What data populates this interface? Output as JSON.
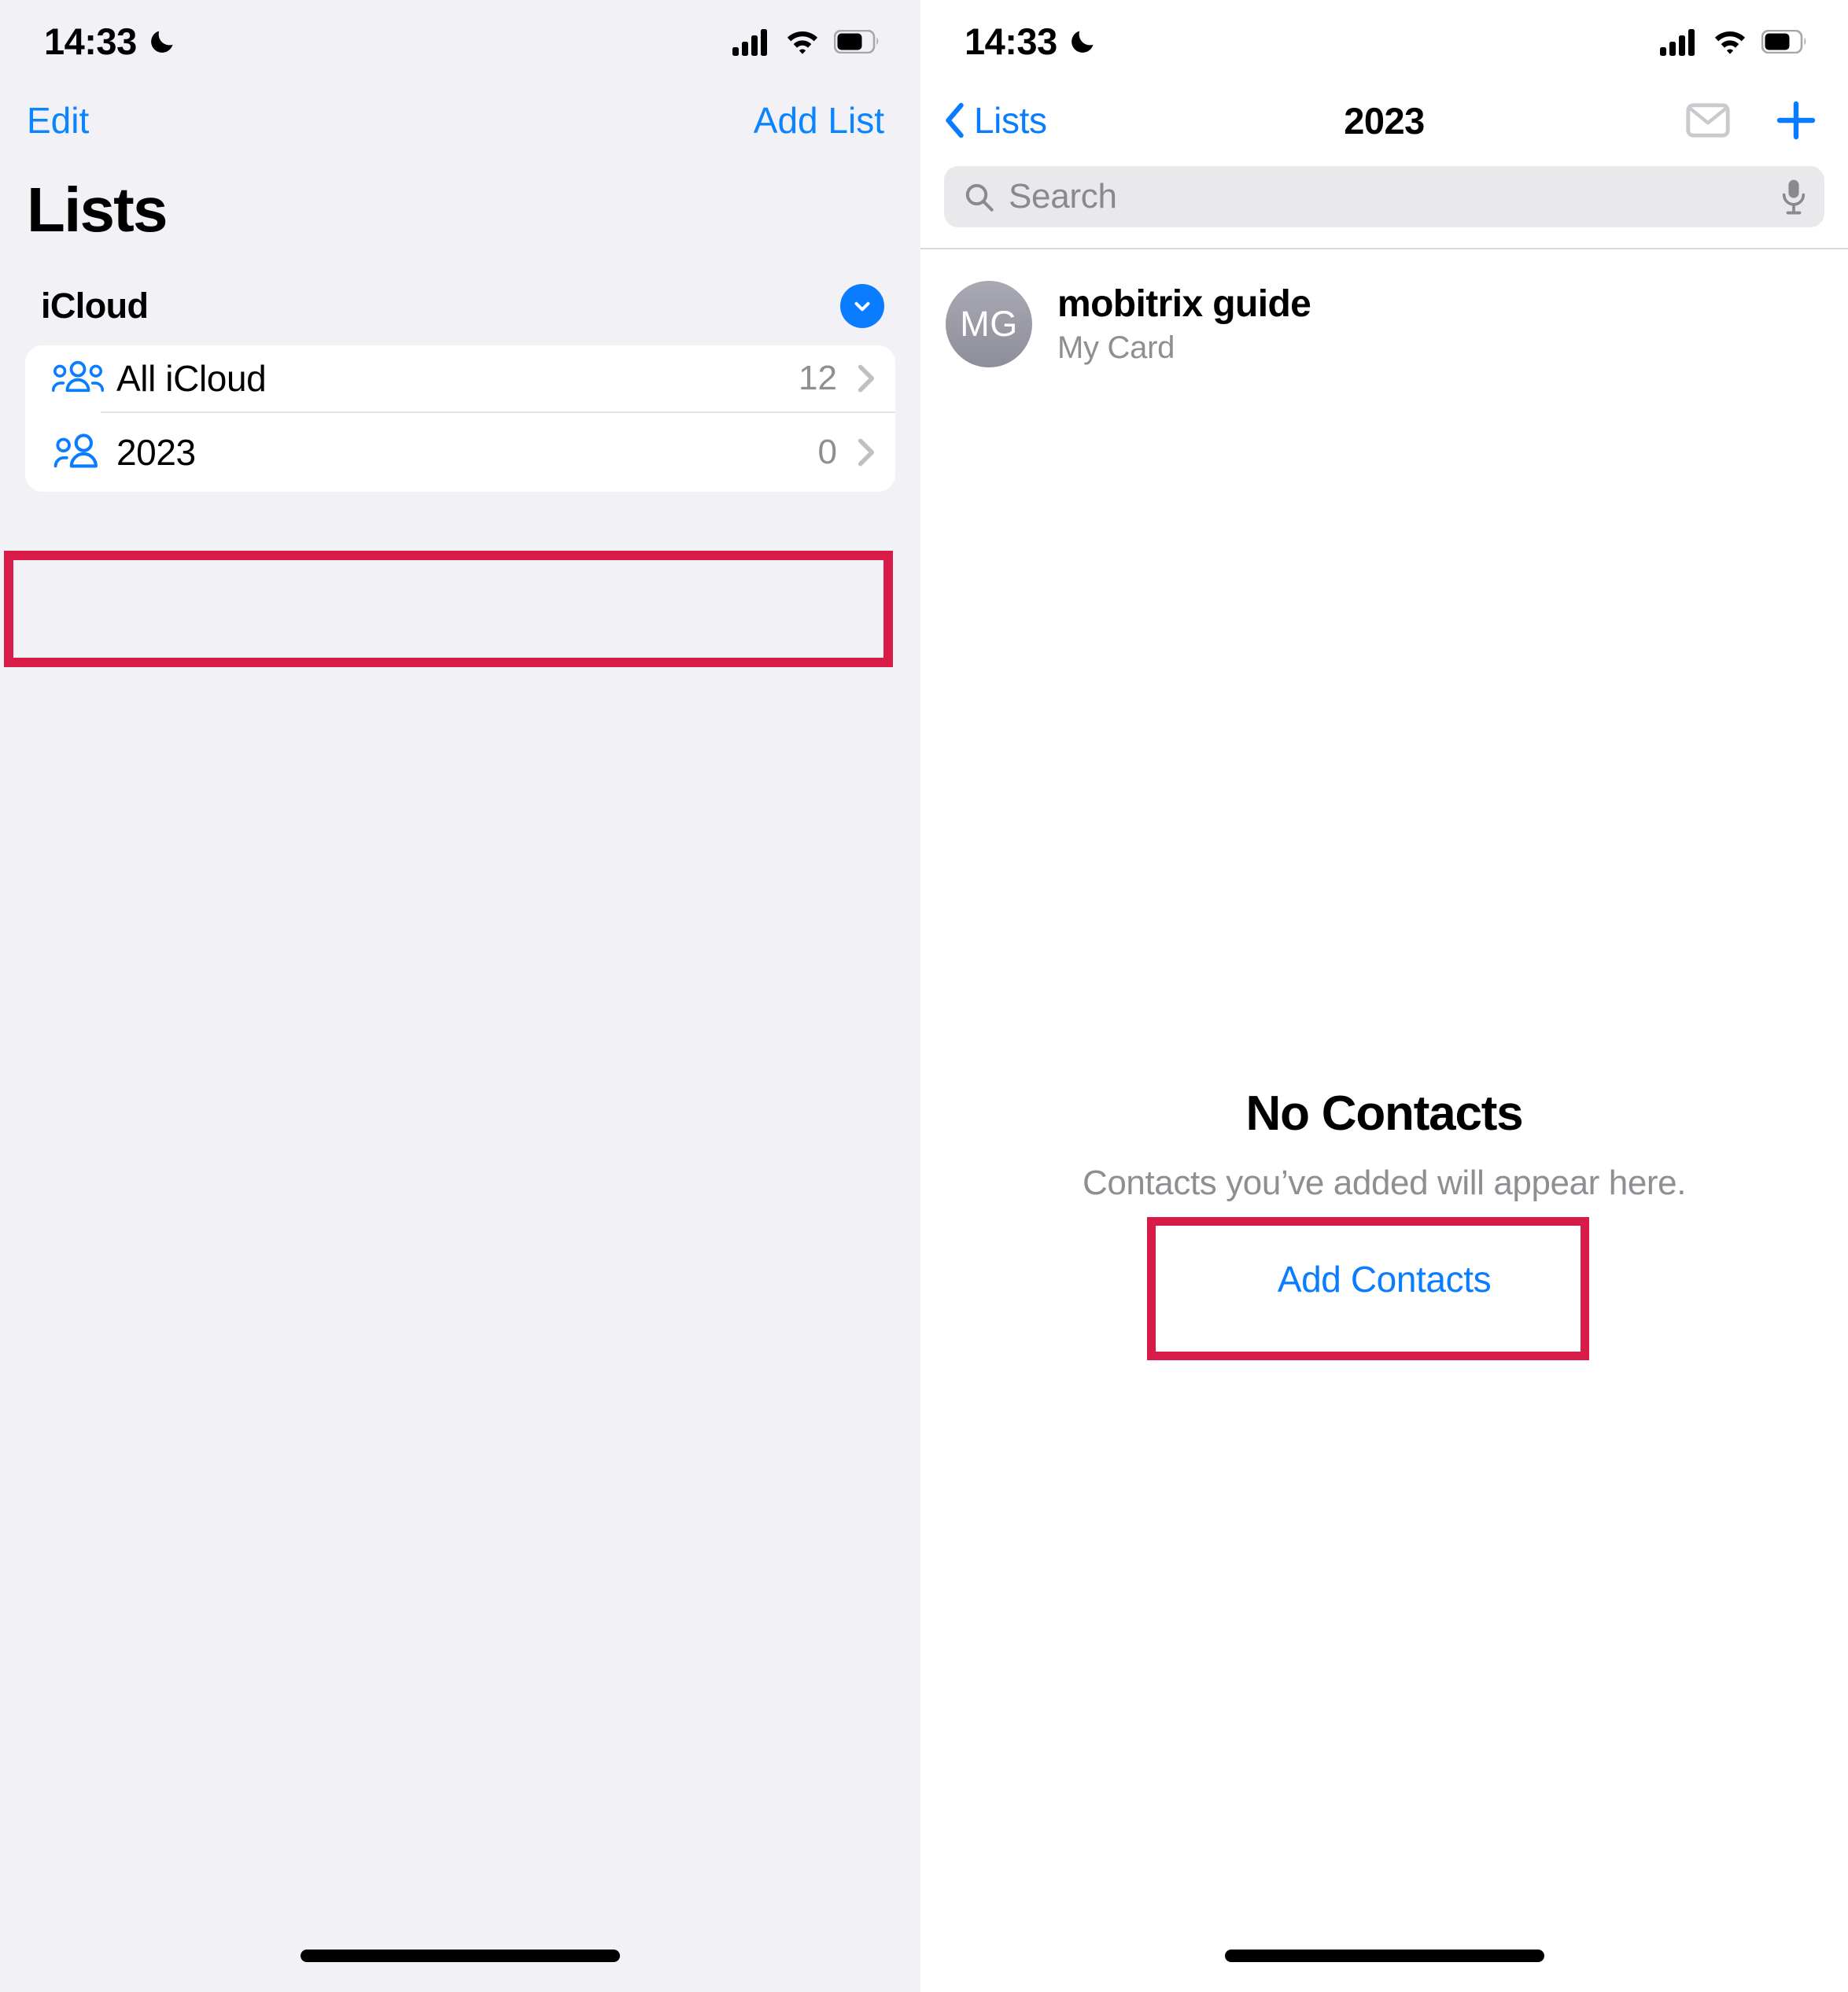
{
  "status_bar": {
    "time": "14:33",
    "icons": [
      "moon-icon",
      "cellular-signal-icon",
      "wifi-icon",
      "battery-icon"
    ],
    "battery_level_pct": 65
  },
  "left_screen": {
    "nav": {
      "edit_label": "Edit",
      "add_list_label": "Add List"
    },
    "title": "Lists",
    "section": {
      "title": "iCloud",
      "collapse_icon": "chevron-down-icon"
    },
    "rows": [
      {
        "icon": "three-persons-icon",
        "label": "All iCloud",
        "count": "12",
        "chevron": "chevron-right-icon"
      },
      {
        "icon": "two-persons-icon",
        "label": "2023",
        "count": "0",
        "chevron": "chevron-right-icon"
      }
    ],
    "highlight": {
      "target": "2023",
      "color": "#d81b47"
    }
  },
  "right_screen": {
    "nav": {
      "back_label": "Lists",
      "back_icon": "chevron-left-icon",
      "title": "2023",
      "mail_icon": "envelope-icon",
      "add_icon": "plus-icon"
    },
    "search": {
      "placeholder": "Search",
      "value": "",
      "search_icon": "search-icon",
      "mic_icon": "microphone-icon"
    },
    "my_card": {
      "initials": "MG",
      "name": "mobitrix guide",
      "subtitle": "My Card"
    },
    "empty_state": {
      "title": "No Contacts",
      "subtitle": "Contacts you’ve added will appear here.",
      "action_label": "Add Contacts"
    },
    "highlight": {
      "target": "Add Contacts",
      "color": "#d81b47"
    }
  },
  "colors": {
    "accent_blue": "#0a7cff",
    "annotation_red": "#d81b47",
    "panel_bg": "#f1f1f6",
    "secondary_text": "#8e8e93"
  }
}
